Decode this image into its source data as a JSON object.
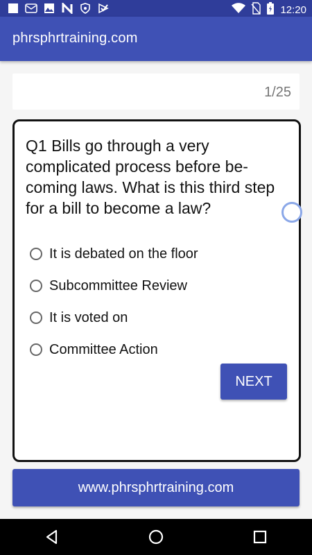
{
  "status_bar": {
    "time": "12:20",
    "icons": [
      "notification-white-square-icon",
      "mail-app-icon",
      "image-icon",
      "n-app-icon",
      "shield-icon",
      "check-app-icon",
      "wifi-icon",
      "no-sim-icon",
      "battery-charging-icon"
    ]
  },
  "app_bar": {
    "title": "phrsphrtraining.com"
  },
  "progress": {
    "label": "1/25",
    "current": 1,
    "total": 25
  },
  "question": {
    "text": "Q1  Bills go through a very complicated process before be-coming laws. What is this third step for a bill to become a law?",
    "options": [
      {
        "label": "It is debated on the floor",
        "selected": false
      },
      {
        "label": "Subcommittee Review",
        "selected": false
      },
      {
        "label": "It is voted on",
        "selected": false
      },
      {
        "label": "Committee Action",
        "selected": false
      }
    ],
    "next_label": "NEXT"
  },
  "footer": {
    "website_label": "www.phrsphrtraining.com"
  },
  "nav_bar": {
    "buttons": [
      "back-icon",
      "home-icon",
      "recents-icon"
    ]
  },
  "colors": {
    "primary": "#3f51b5",
    "primary_dark": "#2f3d9a",
    "background": "#f5f5f5"
  }
}
